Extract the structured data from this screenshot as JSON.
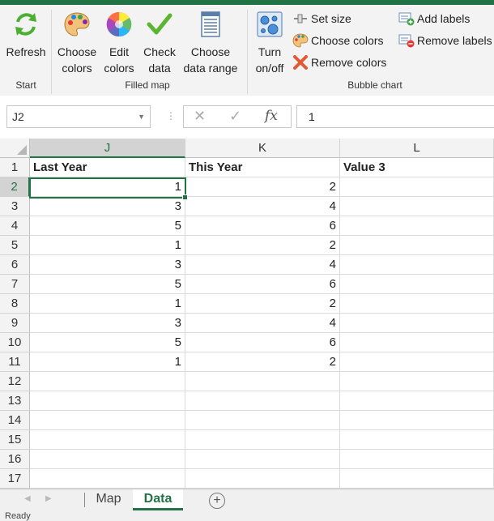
{
  "ribbon": {
    "start": {
      "refresh_label_1": "Refresh",
      "group_label": "Start"
    },
    "filled_map": {
      "choose_colors": [
        "Choose",
        "colors"
      ],
      "edit_colors": [
        "Edit",
        "colors"
      ],
      "check_data": [
        "Check",
        "data"
      ],
      "choose_range": [
        "Choose",
        "data range"
      ],
      "group_label": "Filled map"
    },
    "bubble_chart": {
      "turn_onoff": [
        "Turn",
        "on/off"
      ],
      "set_size": "Set size",
      "choose_colors": "Choose colors",
      "remove_colors": "Remove colors",
      "add_labels": "Add labels",
      "remove_labels": "Remove labels",
      "group_label": "Bubble chart"
    }
  },
  "formula_bar": {
    "name_box": "J2",
    "fx": "fx",
    "value": "1"
  },
  "grid": {
    "columns": [
      "J",
      "K",
      "L"
    ],
    "rows": [
      "1",
      "2",
      "3",
      "4",
      "5",
      "6",
      "7",
      "8",
      "9",
      "10",
      "11",
      "12",
      "13",
      "14",
      "15",
      "16",
      "17"
    ],
    "headers": [
      "Last Year",
      "This Year",
      "Value 3"
    ],
    "data": [
      [
        "1",
        "2",
        ""
      ],
      [
        "3",
        "4",
        ""
      ],
      [
        "5",
        "6",
        ""
      ],
      [
        "1",
        "2",
        ""
      ],
      [
        "3",
        "4",
        ""
      ],
      [
        "5",
        "6",
        ""
      ],
      [
        "1",
        "2",
        ""
      ],
      [
        "3",
        "4",
        ""
      ],
      [
        "5",
        "6",
        ""
      ],
      [
        "1",
        "2",
        ""
      ]
    ]
  },
  "sheets": {
    "tabs": [
      "Map",
      "Data"
    ],
    "active": "Data",
    "add": "+"
  },
  "status": {
    "text": "Ready"
  },
  "colors": {
    "excel_green": "#217346"
  }
}
